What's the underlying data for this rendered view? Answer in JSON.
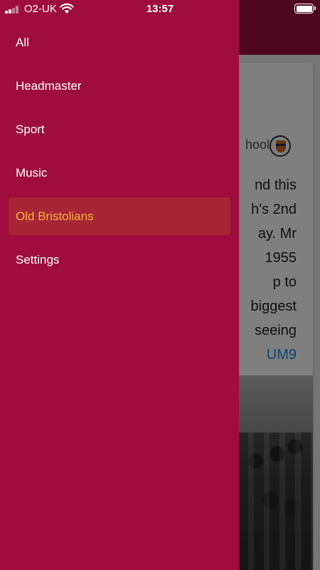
{
  "status_bar": {
    "carrier": "O2-UK",
    "time": "13:57",
    "signal_bars": 2,
    "signal_max": 4,
    "battery_level": 1.0
  },
  "drawer": {
    "background_color": "#9e0d3e",
    "active_color": "#f9b43b",
    "items": [
      {
        "label": "All",
        "active": false
      },
      {
        "label": "Headmaster",
        "active": false
      },
      {
        "label": "Sport",
        "active": false
      },
      {
        "label": "Music",
        "active": false
      },
      {
        "label": "Old Bristolians",
        "active": true
      },
      {
        "label": "Settings",
        "active": false
      }
    ]
  },
  "background_feed": {
    "account_fragment": "hool",
    "text_lines": [
      "nd this",
      "h's 2nd",
      "ay. Mr",
      "1955",
      "p to",
      "biggest",
      "seeing"
    ],
    "link_fragment": "UM9"
  }
}
